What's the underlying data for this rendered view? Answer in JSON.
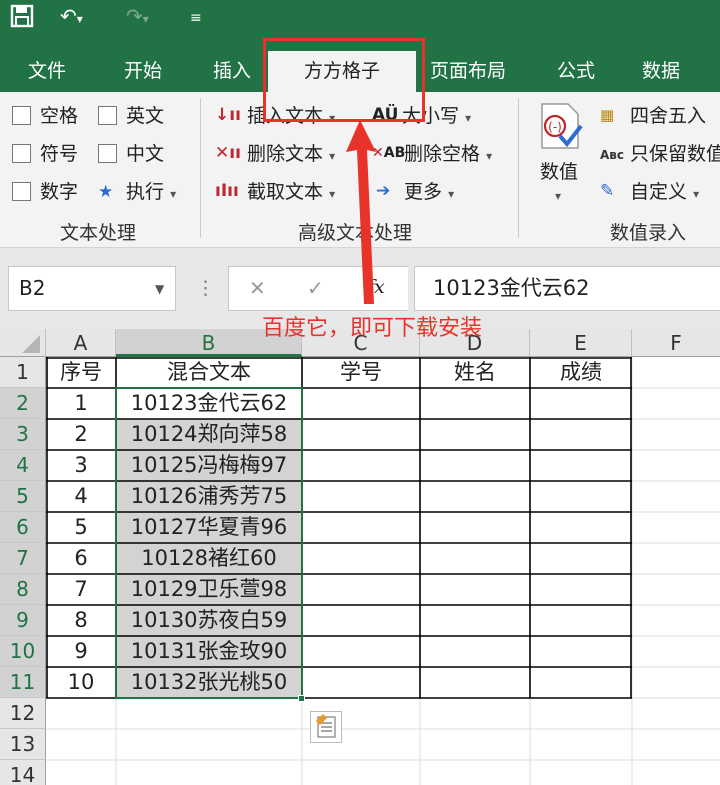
{
  "qat": {
    "save_icon": "save-icon",
    "undo_icon": "undo-icon",
    "redo_icon": "redo-icon",
    "customize_icon": "customize-icon"
  },
  "tabs": [
    "文件",
    "开始",
    "插入",
    "方方格子",
    "页面布局",
    "公式",
    "数据"
  ],
  "ribbon": {
    "text_group": {
      "checks": [
        "空格",
        "英文",
        "符号",
        "中文",
        "数字"
      ],
      "execute": "执行",
      "label": "文本处理"
    },
    "advanced_group": {
      "insert_text": "插入文本",
      "delete_text": "删除文本",
      "extract_text": "截取文本",
      "case": "大小写",
      "delete_spaces": "删除空格",
      "more": "更多",
      "label": "高级文本处理"
    },
    "value_group": {
      "value": "数值",
      "round": "四舍五入",
      "keep_values": "只保留数值",
      "custom": "自定义",
      "label": "数值录入"
    }
  },
  "formula_bar": {
    "name_box": "B2",
    "cancel": "✕",
    "enter": "✓",
    "fx": "fx",
    "value": "10123金代云62"
  },
  "annotation": {
    "text": "百度它，即可下载安装",
    "color": "#e8332a"
  },
  "columns": [
    "A",
    "B",
    "C",
    "D",
    "E",
    "F"
  ],
  "rows": [
    "1",
    "2",
    "3",
    "4",
    "5",
    "6",
    "7",
    "8",
    "9",
    "10",
    "11",
    "12",
    "13",
    "14"
  ],
  "headers": [
    "序号",
    "混合文本",
    "学号",
    "姓名",
    "成绩"
  ],
  "table": [
    [
      "1",
      "10123金代云62"
    ],
    [
      "2",
      "10124郑向萍58"
    ],
    [
      "3",
      "10125冯梅梅97"
    ],
    [
      "4",
      "10126浦秀芳75"
    ],
    [
      "5",
      "10127华夏青96"
    ],
    [
      "6",
      "10128褚红60"
    ],
    [
      "7",
      "10129卫乐萱98"
    ],
    [
      "8",
      "10130苏夜白59"
    ],
    [
      "9",
      "10131张金玫90"
    ],
    [
      "10",
      "10132张光桃50"
    ]
  ],
  "colors": {
    "accent": "#217346",
    "annotation": "#e8332a",
    "selection": "#d3d3d3"
  }
}
